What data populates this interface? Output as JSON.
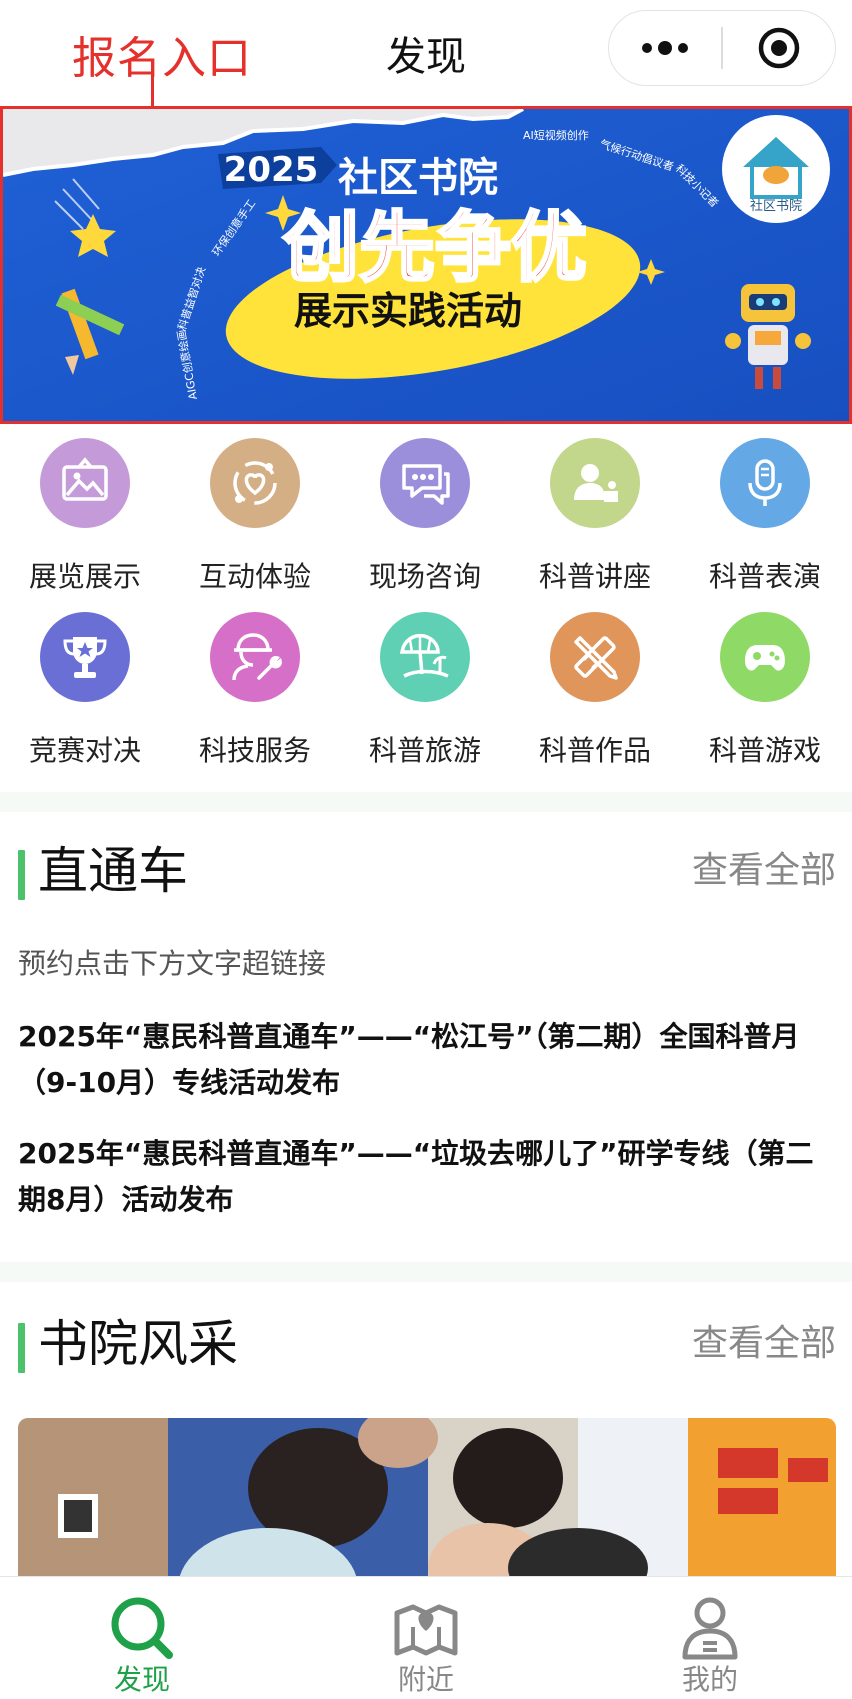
{
  "navbar": {
    "title": "发现",
    "annotation": "报名入口"
  },
  "banner": {
    "year": "2025",
    "line1": "社区书院",
    "line2": "创先争优",
    "line3": "展示实践活动",
    "logo_text": "社区书院",
    "arc_tags": [
      "AI短视频创作",
      "气候行动倡议者",
      "科技小记者"
    ],
    "left_tags": [
      "环保创意手工",
      "科普益智对决",
      "AIGC创意绘画"
    ]
  },
  "categories": [
    {
      "label": "展览展示",
      "icon": "picture-frame-icon",
      "color": "#c49bd8"
    },
    {
      "label": "互动体验",
      "icon": "heart-orbit-icon",
      "color": "#d4ae84"
    },
    {
      "label": "现场咨询",
      "icon": "chat-bubbles-icon",
      "color": "#9b8fdb"
    },
    {
      "label": "科普讲座",
      "icon": "lecturer-icon",
      "color": "#c2d68c"
    },
    {
      "label": "科普表演",
      "icon": "microphone-icon",
      "color": "#64a8e6"
    },
    {
      "label": "竞赛对决",
      "icon": "trophy-icon",
      "color": "#6a6fd6"
    },
    {
      "label": "科技服务",
      "icon": "worker-wrench-icon",
      "color": "#d66fc7"
    },
    {
      "label": "科普旅游",
      "icon": "beach-umbrella-icon",
      "color": "#5fd0b3"
    },
    {
      "label": "科普作品",
      "icon": "pencil-ruler-icon",
      "color": "#e0955a"
    },
    {
      "label": "科普游戏",
      "icon": "gamepad-icon",
      "color": "#8fd966"
    }
  ],
  "express": {
    "title": "直通车",
    "more": "查看全部",
    "hint": "预约点击下方文字超链接",
    "articles": [
      "2025年“惠民科普直通车”——“松江号”（第二期）全国科普月（9-10月）专线活动发布",
      "2025年“惠民科普直通车”——“垃圾去哪儿了”研学专线（第二期8月）活动发布"
    ]
  },
  "academy": {
    "title": "书院风采",
    "more": "查看全部"
  },
  "tabs": [
    {
      "label": "发现",
      "icon": "search-icon",
      "active": true
    },
    {
      "label": "附近",
      "icon": "map-heart-icon",
      "active": false
    },
    {
      "label": "我的",
      "icon": "user-icon",
      "active": false
    }
  ],
  "colors": {
    "accent": "#1fa149",
    "annotation": "#e5312b",
    "section_bar": "#4cc26a",
    "banner_blue": "#1a5bd1"
  }
}
